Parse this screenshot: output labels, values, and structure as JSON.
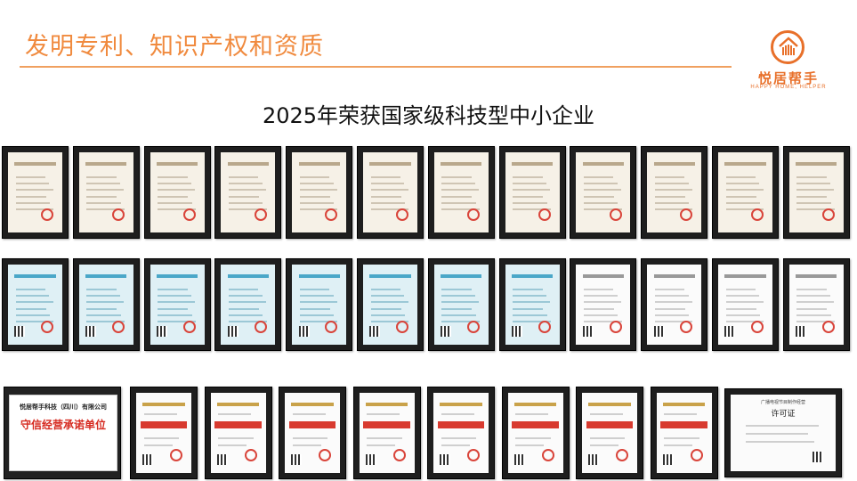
{
  "header": {
    "title": "发明专利、知识产权和资质",
    "logo_name": "悦居帮手",
    "logo_sub": "HAPPY HOME, HELPER"
  },
  "main_title": "2025年荣获国家级科技型中小企业",
  "colors": {
    "accent": "#f08a3e",
    "frame": "#1e1e1e",
    "seal_red": "#d9443a"
  },
  "rows": [
    {
      "name": "patent-certificates",
      "count": 12,
      "style": "cream"
    },
    {
      "name": "software-copyright-certificates",
      "count": 12,
      "style": "mixed"
    },
    {
      "name": "credit-honor-certificates",
      "count": 10,
      "style": "honor"
    }
  ],
  "honor_certificate": {
    "company": "悦居帮手科技（四川）有限公司",
    "honor": "守信经营承诺单位"
  },
  "license_certificate": {
    "org": "广播电视节目制作经营",
    "title": "许可证"
  },
  "icons": [
    "house-hand-logo-icon"
  ]
}
